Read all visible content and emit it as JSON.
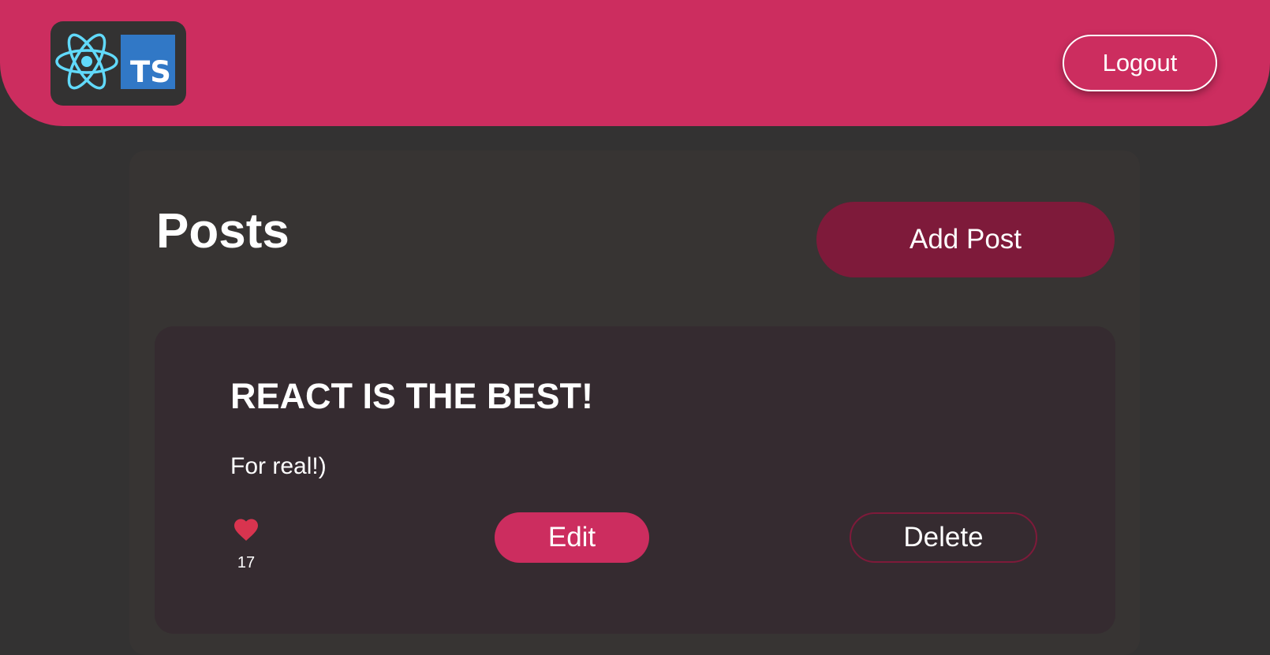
{
  "header": {
    "logo": {
      "icons": [
        "react-icon",
        "typescript-icon"
      ],
      "ts_text": "TS"
    },
    "logout_label": "Logout"
  },
  "posts_page": {
    "title": "Posts",
    "add_post_label": "Add Post",
    "posts": [
      {
        "title": "REACT IS THE BEST!",
        "body": "For real!)",
        "likes": "17",
        "like_icon": "heart-icon",
        "edit_label": "Edit",
        "delete_label": "Delete"
      }
    ]
  },
  "colors": {
    "accent": "#cc2d5f",
    "accent_dark": "#7e1a3a",
    "background": "#333232",
    "panel": "#373433",
    "card": "#352b30",
    "react": "#61dafb",
    "typescript": "#3178c6",
    "heart": "#d9344f"
  }
}
